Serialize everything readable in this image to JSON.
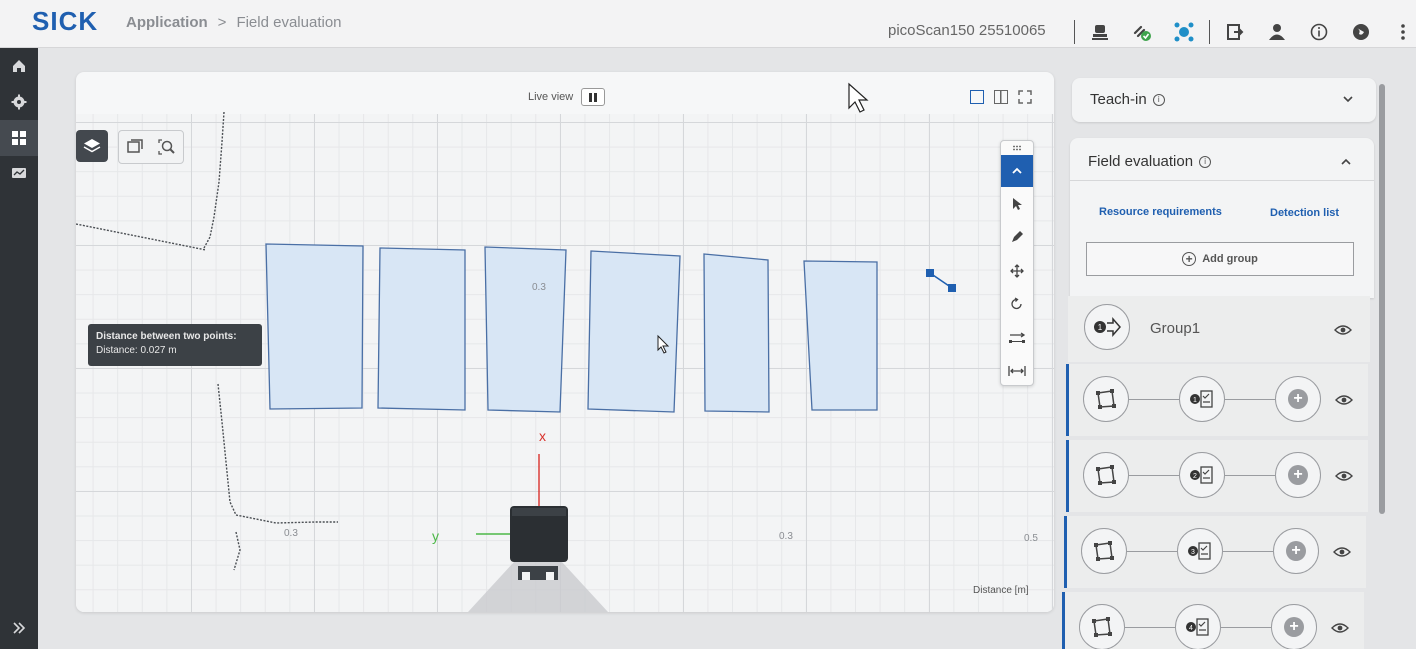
{
  "header": {
    "logo": "SICK",
    "breadcrumb": {
      "app": "Application",
      "separator": ">",
      "current": "Field evaluation"
    },
    "device": "picoScan150 25510065",
    "icons": [
      "device-icon",
      "connection-status-icon",
      "network-icon",
      "export-icon",
      "user-icon",
      "info-icon",
      "language-icon",
      "more-menu-icon"
    ]
  },
  "sidebar": {
    "items": [
      "home-icon",
      "settings-icon",
      "dashboard-icon",
      "monitor-icon"
    ],
    "expand_icon": "expand-sidebar-icon"
  },
  "canvas": {
    "live_view_label": "Live view",
    "tooltip": {
      "title": "Distance between two points:",
      "value": "Distance: 0.027 m"
    },
    "axis": {
      "x_label": "x",
      "y_label": "y",
      "tick_03_center": "0.3",
      "tick_03_left": "0.3",
      "tick_03_right": "0.3",
      "tick_05": "0.5"
    },
    "distance_label": "Distance [m]"
  },
  "panel": {
    "teach_in": {
      "title": "Teach-in"
    },
    "field_evaluation": {
      "title": "Field evaluation",
      "tabs": [
        "Resource requirements",
        "Detection list"
      ],
      "add_group": "Add group",
      "group_name": "Group1",
      "fields": [
        {
          "badge": "1"
        },
        {
          "badge": "2"
        },
        {
          "badge": "3"
        },
        {
          "badge": "4"
        }
      ]
    }
  },
  "colors": {
    "accent": "#1f5fb0",
    "field_fill": "#d8e6f5",
    "field_stroke": "#4a6fa5",
    "x_axis": "#d9312b",
    "y_axis": "#4db848"
  }
}
